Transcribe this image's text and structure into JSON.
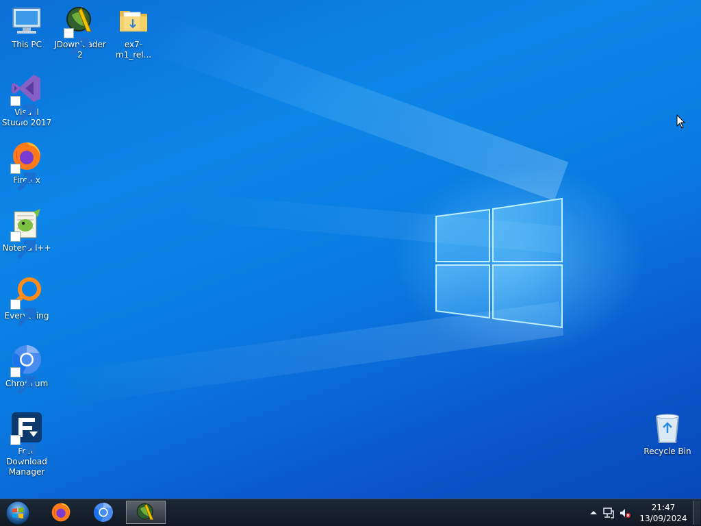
{
  "desktop": {
    "icons": [
      {
        "label": "This PC",
        "icon": "computer-icon"
      },
      {
        "label": "JDownloader 2",
        "icon": "jdownloader-icon"
      },
      {
        "label": "ex7-m1_rel...",
        "icon": "folder-icon"
      },
      {
        "label": "Visual Studio 2017",
        "icon": "visual-studio-icon"
      },
      {
        "label": "Firefox",
        "icon": "firefox-icon"
      },
      {
        "label": "Notepad++",
        "icon": "notepad-plus-plus-icon"
      },
      {
        "label": "Everything",
        "icon": "everything-search-icon"
      },
      {
        "label": "Chromium",
        "icon": "chromium-icon"
      },
      {
        "label": "Free Download Manager",
        "icon": "free-download-manager-icon"
      },
      {
        "label": "Recycle Bin",
        "icon": "recycle-bin-icon"
      }
    ]
  },
  "taskbar": {
    "start": "start-orb-icon",
    "pinned": [
      "firefox-icon",
      "chromium-icon",
      "jdownloader-icon"
    ],
    "active_app": "JDownloader 2",
    "tray": [
      "show-hidden-icons-chevron",
      "network-icon",
      "volume-muted-icon"
    ],
    "clock": {
      "time": "21:47",
      "date": "13/09/2024"
    }
  },
  "colors": {
    "desktop_blue": "#0a7ae0",
    "taskbar": "#16202c"
  }
}
